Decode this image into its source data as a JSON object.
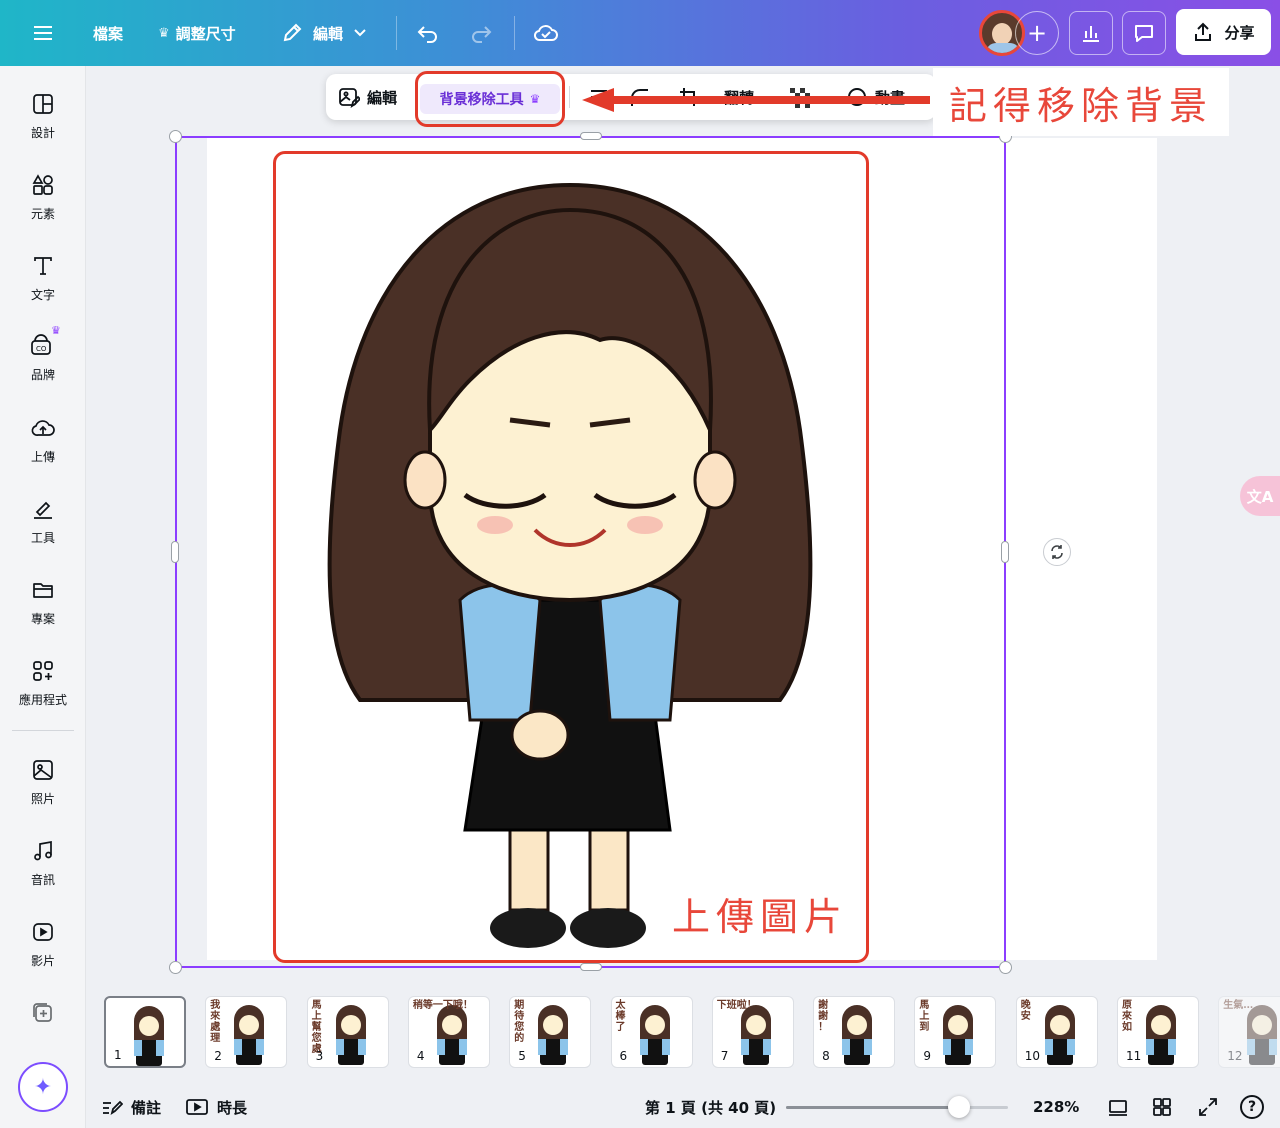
{
  "topbar": {
    "file_label": "檔案",
    "resize_label": "調整尺寸",
    "edit_label": "編輯",
    "share_label": "分享"
  },
  "sidebar": {
    "items": [
      {
        "label": "設計",
        "icon": "layout-icon"
      },
      {
        "label": "元素",
        "icon": "shapes-icon"
      },
      {
        "label": "文字",
        "icon": "text-icon"
      },
      {
        "label": "品牌",
        "icon": "brand-icon"
      },
      {
        "label": "上傳",
        "icon": "cloud-upload-icon"
      },
      {
        "label": "工具",
        "icon": "pen-tool-icon"
      },
      {
        "label": "專案",
        "icon": "folder-icon"
      },
      {
        "label": "應用程式",
        "icon": "apps-icon"
      },
      {
        "label": "照片",
        "icon": "photo-icon"
      },
      {
        "label": "音訊",
        "icon": "music-icon"
      },
      {
        "label": "影片",
        "icon": "video-icon"
      }
    ]
  },
  "context_toolbar": {
    "edit_label": "編輯",
    "bg_remover_label": "背景移除工具",
    "flip_label": "翻轉",
    "animate_label": "動畫"
  },
  "annotations": {
    "remember_note": "記得移除背景",
    "upload_note": "上傳圖片"
  },
  "thumbnails": [
    {
      "num": "1",
      "caption": ""
    },
    {
      "num": "2",
      "caption": "我 來 處 理"
    },
    {
      "num": "3",
      "caption": "馬 上 幫 您 處"
    },
    {
      "num": "4",
      "caption": "稍等一下哦！"
    },
    {
      "num": "5",
      "caption": "期 待 您 的"
    },
    {
      "num": "6",
      "caption": "太 棒 了"
    },
    {
      "num": "7",
      "caption": "下班啦！"
    },
    {
      "num": "8",
      "caption": "謝 謝 ！"
    },
    {
      "num": "9",
      "caption": "馬 上 到"
    },
    {
      "num": "10",
      "caption": "晚 安"
    },
    {
      "num": "11",
      "caption": "原 來 如"
    },
    {
      "num": "12",
      "caption": "生氣…"
    }
  ],
  "bottombar": {
    "notes_label": "備註",
    "duration_label": "時長",
    "page_label": "第 1 頁 (共 40 頁)",
    "zoom_label": "228%",
    "zoom_fraction": 0.78
  },
  "colors": {
    "accent": "#8b3dff",
    "annotation_red": "#e23a2a"
  }
}
